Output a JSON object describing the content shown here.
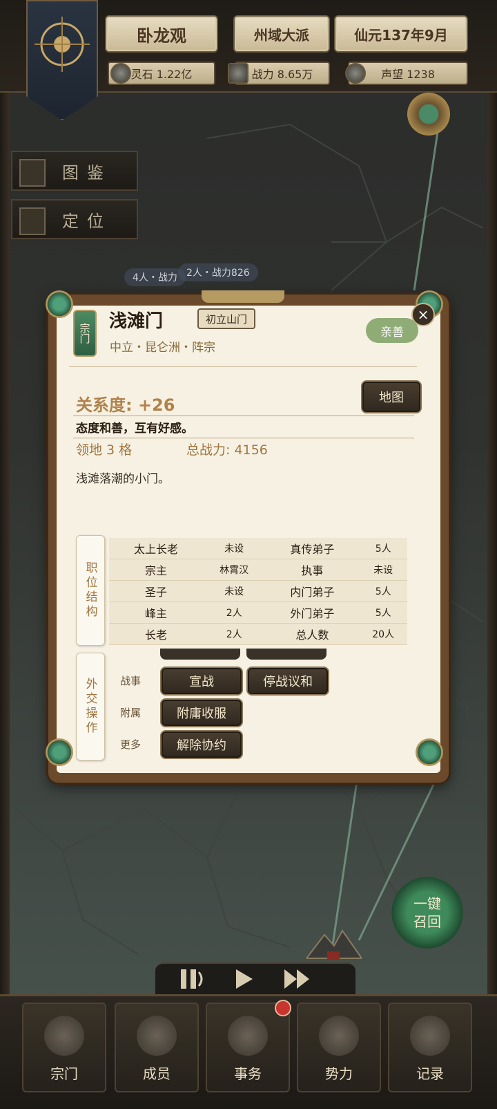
{
  "topbar": {
    "sect_name": "卧龙观",
    "sect_rank": "州域大派",
    "date": "仙元137年9月",
    "spirit_stones": "灵石 1.22亿",
    "combat_power": "战力 8.65万",
    "prestige": "声望 1238"
  },
  "side_buttons": {
    "atlas": "图鉴",
    "locate": "定位"
  },
  "map_tags": {
    "tag1": "4人・战力",
    "tag2": "2人・战力826"
  },
  "dialog": {
    "seal": "宗门",
    "name": "浅滩门",
    "tier": "初立山门",
    "subtitle": "中立・昆仑洲・阵宗",
    "attitude": "亲善",
    "relation": "关系度: +26",
    "map_button": "地图",
    "relation_desc": "态度和善，互有好感。",
    "territory": "领地 3 格",
    "total_power": "总战力: 4156",
    "description": "浅滩落潮的小门。",
    "roster_tab": "职位结构",
    "roster": [
      {
        "k1": "太上长老",
        "v1": "未设",
        "k2": "真传弟子",
        "v2": "5人"
      },
      {
        "k1": "宗主",
        "v1": "林霄汉",
        "k2": "执事",
        "v2": "未设"
      },
      {
        "k1": "圣子",
        "v1": "未设",
        "k2": "内门弟子",
        "v2": "5人"
      },
      {
        "k1": "峰主",
        "v1": "2人",
        "k2": "外门弟子",
        "v2": "5人"
      },
      {
        "k1": "长老",
        "v1": "2人",
        "k2": "总人数",
        "v2": "20人"
      }
    ],
    "ops_tab": "外交操作",
    "ops": {
      "war_label": "战事",
      "declare_war": "宣战",
      "ceasefire": "停战议和",
      "vassal_label": "附属",
      "subjugate": "附庸收服",
      "more_label": "更多",
      "terminate": "解除协约"
    }
  },
  "recall_button": "一键召回",
  "nav": {
    "sect": "宗门",
    "members": "成员",
    "affairs": "事务",
    "forces": "势力",
    "records": "记录"
  }
}
